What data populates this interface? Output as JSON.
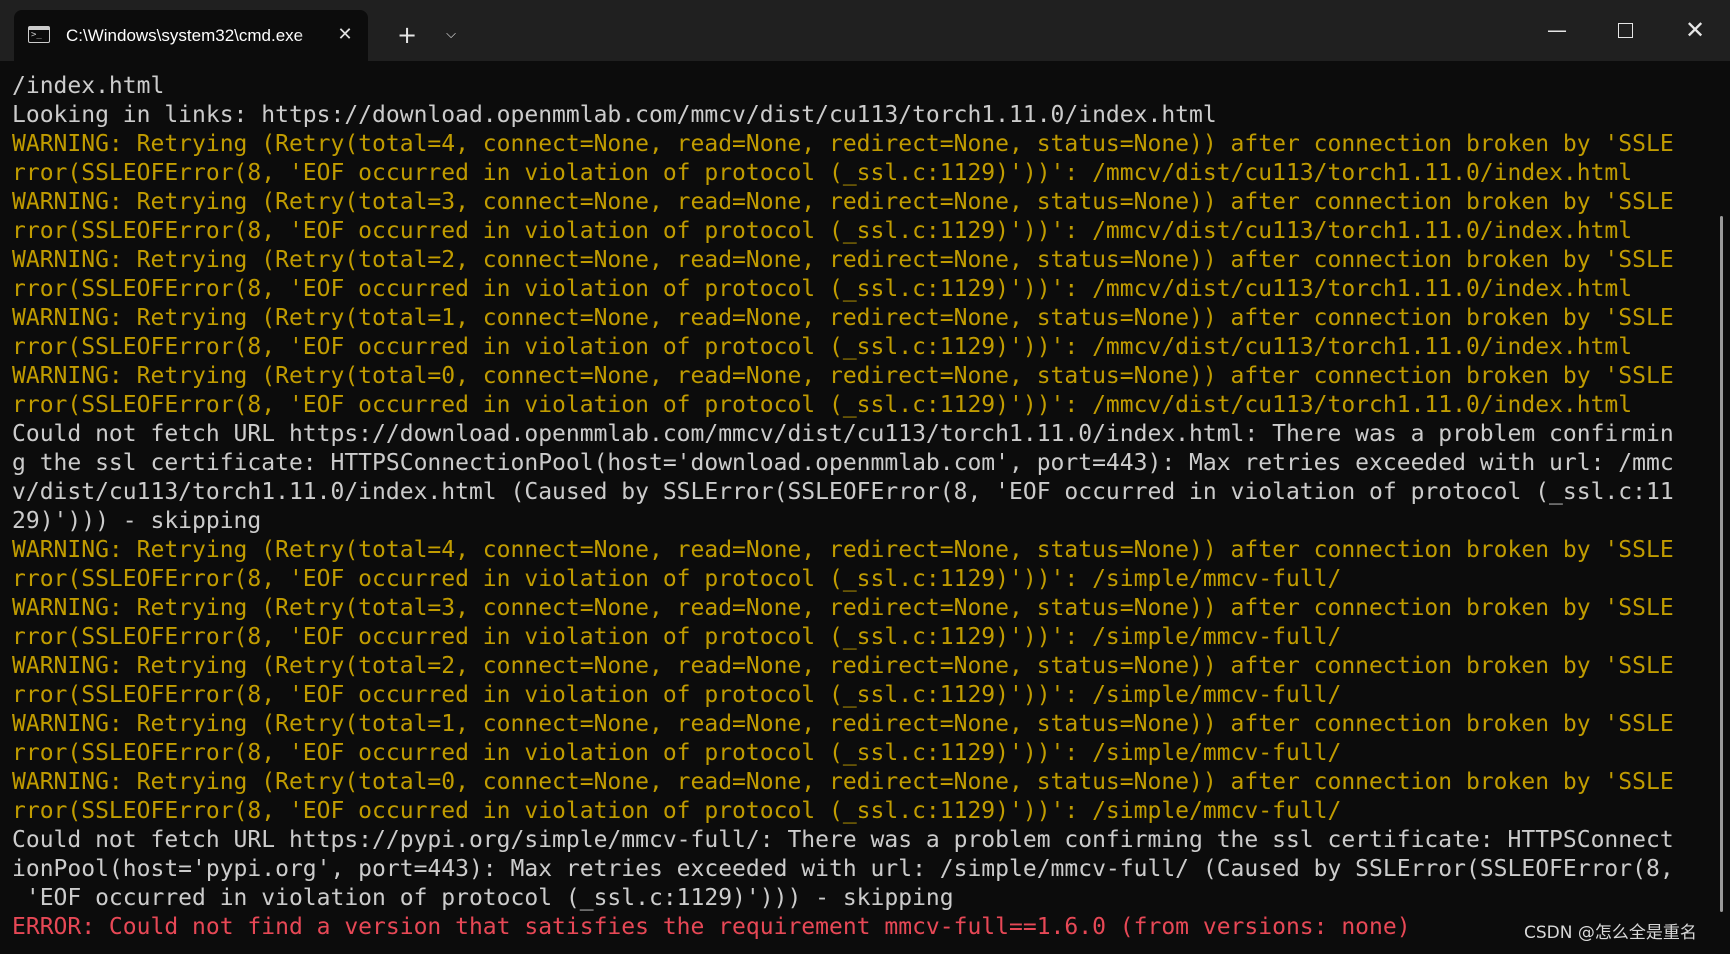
{
  "window": {
    "tab_title": "C:\\Windows\\system32\\cmd.exe",
    "tab_icon": "terminal-icon",
    "tab_icon_glyph": ">_",
    "tab_close_glyph": "✕",
    "new_tab_glyph": "+",
    "dropdown_glyph": "⌵",
    "minimize_glyph": "—",
    "close_glyph": "✕"
  },
  "colors": {
    "background": "#0c0c0c",
    "titlebar": "#202020",
    "normal_text": "#cccccc",
    "warning_text": "#c19c00",
    "error_text": "#e74856"
  },
  "console": {
    "lines": [
      {
        "type": "normal",
        "text": "/index.html"
      },
      {
        "type": "normal",
        "text": "Looking in links: https://download.openmmlab.com/mmcv/dist/cu113/torch1.11.0/index.html"
      },
      {
        "type": "warning",
        "text": "WARNING: Retrying (Retry(total=4, connect=None, read=None, redirect=None, status=None)) after connection broken by 'SSLE"
      },
      {
        "type": "warning",
        "text": "rror(SSLEOFError(8, 'EOF occurred in violation of protocol (_ssl.c:1129)'))': /mmcv/dist/cu113/torch1.11.0/index.html"
      },
      {
        "type": "warning",
        "text": "WARNING: Retrying (Retry(total=3, connect=None, read=None, redirect=None, status=None)) after connection broken by 'SSLE"
      },
      {
        "type": "warning",
        "text": "rror(SSLEOFError(8, 'EOF occurred in violation of protocol (_ssl.c:1129)'))': /mmcv/dist/cu113/torch1.11.0/index.html"
      },
      {
        "type": "warning",
        "text": "WARNING: Retrying (Retry(total=2, connect=None, read=None, redirect=None, status=None)) after connection broken by 'SSLE"
      },
      {
        "type": "warning",
        "text": "rror(SSLEOFError(8, 'EOF occurred in violation of protocol (_ssl.c:1129)'))': /mmcv/dist/cu113/torch1.11.0/index.html"
      },
      {
        "type": "warning",
        "text": "WARNING: Retrying (Retry(total=1, connect=None, read=None, redirect=None, status=None)) after connection broken by 'SSLE"
      },
      {
        "type": "warning",
        "text": "rror(SSLEOFError(8, 'EOF occurred in violation of protocol (_ssl.c:1129)'))': /mmcv/dist/cu113/torch1.11.0/index.html"
      },
      {
        "type": "warning",
        "text": "WARNING: Retrying (Retry(total=0, connect=None, read=None, redirect=None, status=None)) after connection broken by 'SSLE"
      },
      {
        "type": "warning",
        "text": "rror(SSLEOFError(8, 'EOF occurred in violation of protocol (_ssl.c:1129)'))': /mmcv/dist/cu113/torch1.11.0/index.html"
      },
      {
        "type": "normal",
        "text": "Could not fetch URL https://download.openmmlab.com/mmcv/dist/cu113/torch1.11.0/index.html: There was a problem confirmin"
      },
      {
        "type": "normal",
        "text": "g the ssl certificate: HTTPSConnectionPool(host='download.openmmlab.com', port=443): Max retries exceeded with url: /mmc"
      },
      {
        "type": "normal",
        "text": "v/dist/cu113/torch1.11.0/index.html (Caused by SSLError(SSLEOFError(8, 'EOF occurred in violation of protocol (_ssl.c:11"
      },
      {
        "type": "normal",
        "text": "29)'))) - skipping"
      },
      {
        "type": "warning",
        "text": "WARNING: Retrying (Retry(total=4, connect=None, read=None, redirect=None, status=None)) after connection broken by 'SSLE"
      },
      {
        "type": "warning",
        "text": "rror(SSLEOFError(8, 'EOF occurred in violation of protocol (_ssl.c:1129)'))': /simple/mmcv-full/"
      },
      {
        "type": "warning",
        "text": "WARNING: Retrying (Retry(total=3, connect=None, read=None, redirect=None, status=None)) after connection broken by 'SSLE"
      },
      {
        "type": "warning",
        "text": "rror(SSLEOFError(8, 'EOF occurred in violation of protocol (_ssl.c:1129)'))': /simple/mmcv-full/"
      },
      {
        "type": "warning",
        "text": "WARNING: Retrying (Retry(total=2, connect=None, read=None, redirect=None, status=None)) after connection broken by 'SSLE"
      },
      {
        "type": "warning",
        "text": "rror(SSLEOFError(8, 'EOF occurred in violation of protocol (_ssl.c:1129)'))': /simple/mmcv-full/"
      },
      {
        "type": "warning",
        "text": "WARNING: Retrying (Retry(total=1, connect=None, read=None, redirect=None, status=None)) after connection broken by 'SSLE"
      },
      {
        "type": "warning",
        "text": "rror(SSLEOFError(8, 'EOF occurred in violation of protocol (_ssl.c:1129)'))': /simple/mmcv-full/"
      },
      {
        "type": "warning",
        "text": "WARNING: Retrying (Retry(total=0, connect=None, read=None, redirect=None, status=None)) after connection broken by 'SSLE"
      },
      {
        "type": "warning",
        "text": "rror(SSLEOFError(8, 'EOF occurred in violation of protocol (_ssl.c:1129)'))': /simple/mmcv-full/"
      },
      {
        "type": "normal",
        "text": "Could not fetch URL https://pypi.org/simple/mmcv-full/: There was a problem confirming the ssl certificate: HTTPSConnect"
      },
      {
        "type": "normal",
        "text": "ionPool(host='pypi.org', port=443): Max retries exceeded with url: /simple/mmcv-full/ (Caused by SSLError(SSLEOFError(8,"
      },
      {
        "type": "normal",
        "text": " 'EOF occurred in violation of protocol (_ssl.c:1129)'))) - skipping"
      },
      {
        "type": "error",
        "text": "ERROR: Could not find a version that satisfies the requirement mmcv-full==1.6.0 (from versions: none)"
      }
    ]
  },
  "watermark": "CSDN @怎么全是重名"
}
